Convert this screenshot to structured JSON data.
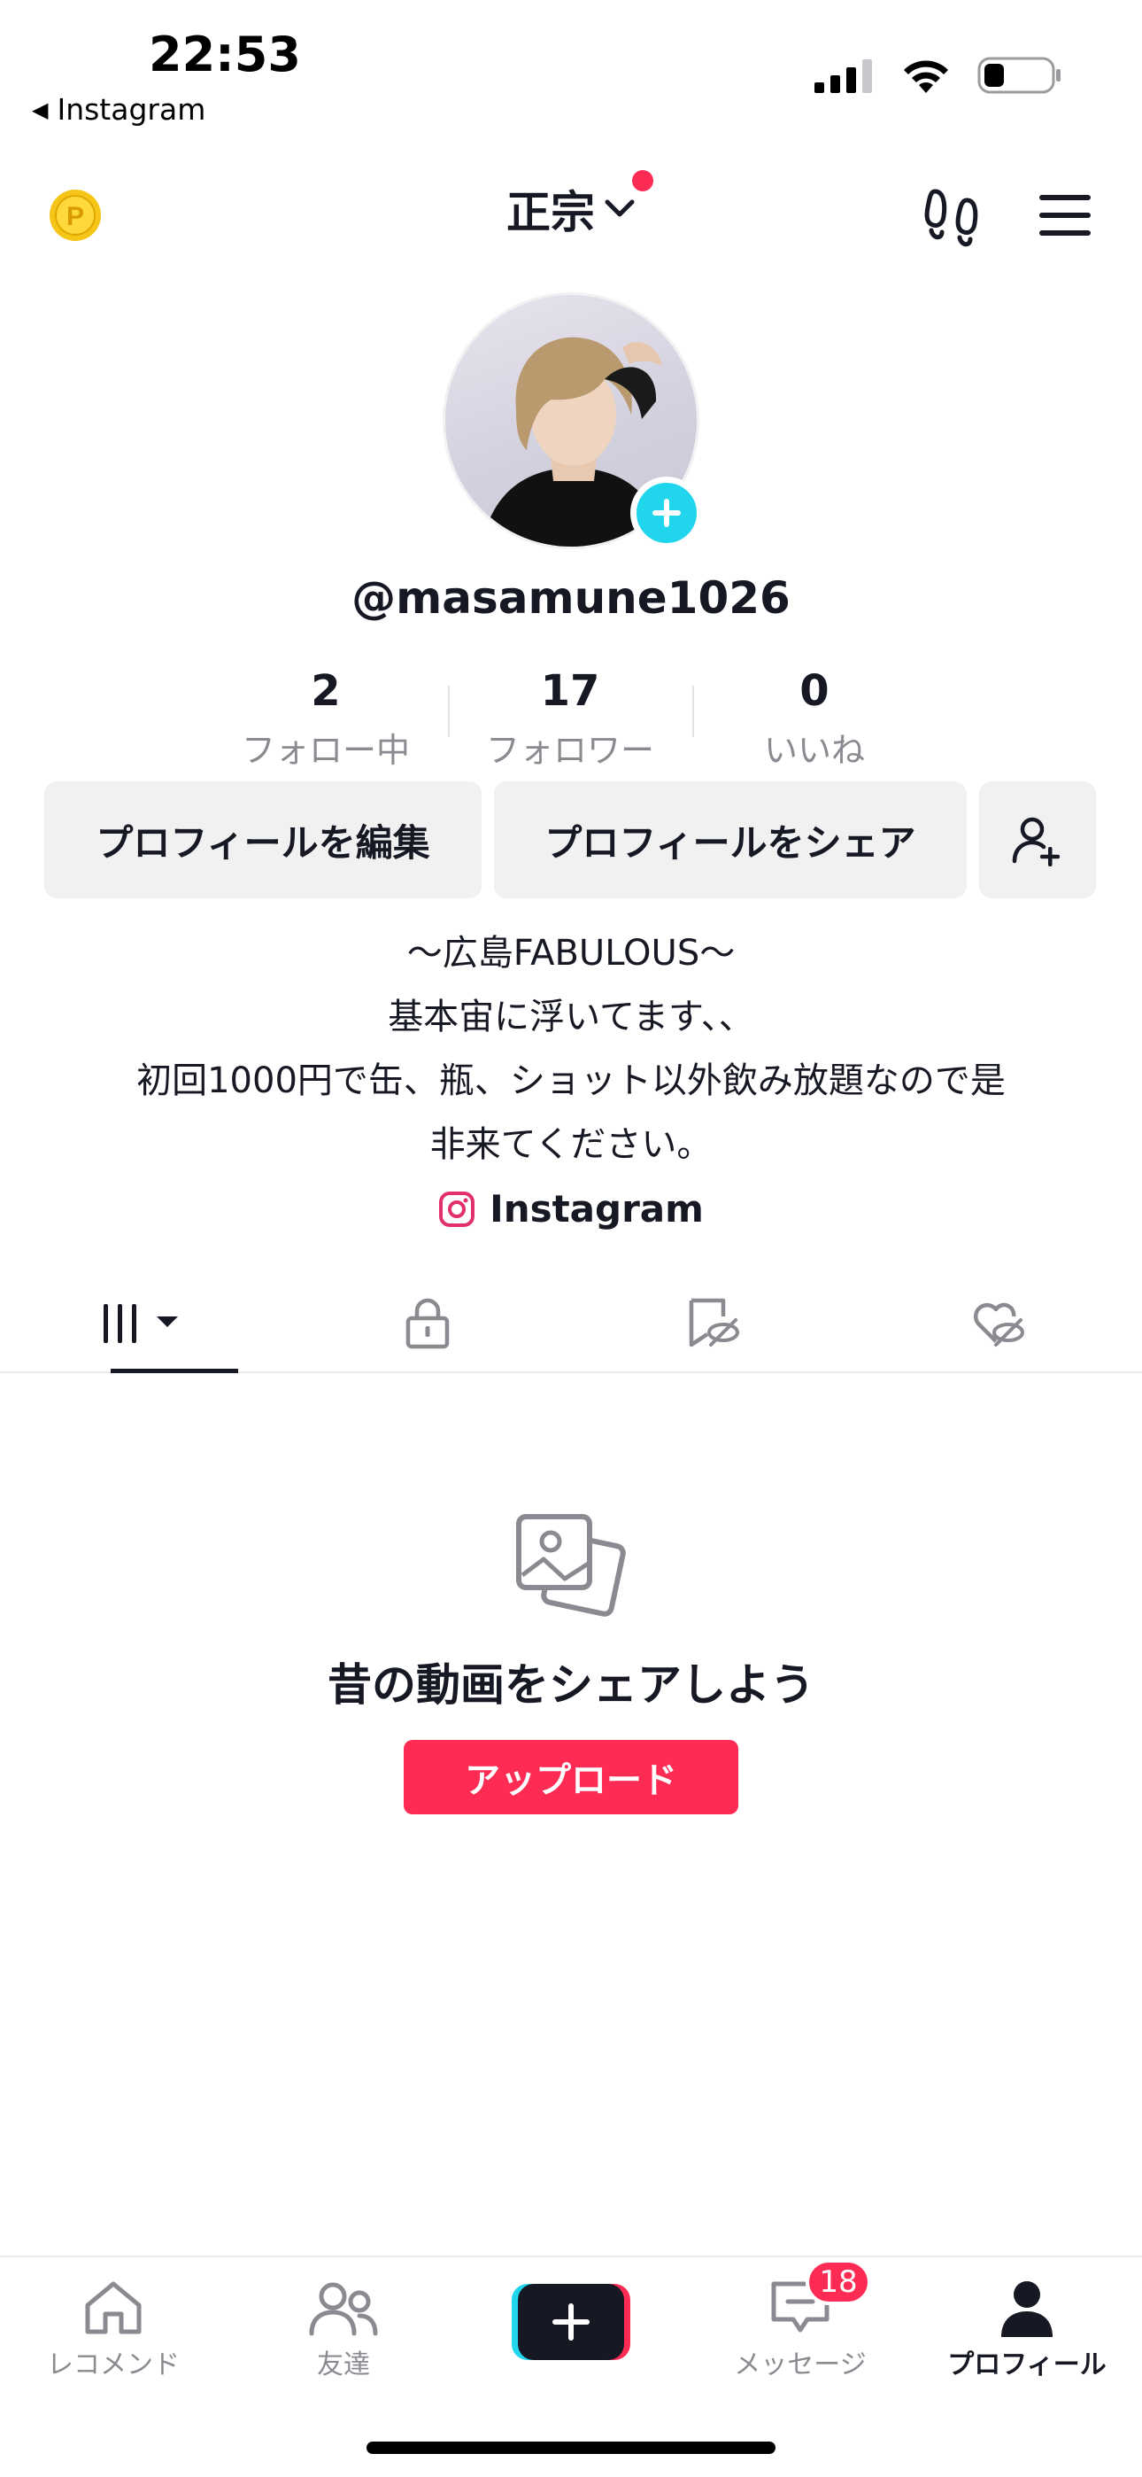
{
  "status_bar": {
    "time": "22:53",
    "back_app": "Instagram"
  },
  "header": {
    "display_name": "正宗",
    "has_notification_dot": true
  },
  "profile": {
    "handle": "@masamune1026",
    "stats": [
      {
        "value": "2",
        "label": "フォロー中"
      },
      {
        "value": "17",
        "label": "フォロワー"
      },
      {
        "value": "0",
        "label": "いいね"
      }
    ],
    "edit_button": "プロフィールを編集",
    "share_button": "プロフィールをシェア",
    "bio_lines": [
      "〜広島FABULOUS〜",
      "基本宙に浮いてます、、",
      "初回1000円で缶、瓶、ショット以外飲み放題なので是",
      "非来てください。"
    ],
    "instagram_label": "Instagram"
  },
  "tabs": [
    {
      "name": "videos",
      "icon": "grid-icon",
      "active": true
    },
    {
      "name": "private",
      "icon": "lock-icon",
      "active": false
    },
    {
      "name": "favorites",
      "icon": "bookmark-hidden-icon",
      "active": false
    },
    {
      "name": "liked",
      "icon": "heart-hidden-icon",
      "active": false
    }
  ],
  "empty_state": {
    "title": "昔の動画をシェアしよう",
    "button": "アップロード"
  },
  "bottom_nav": {
    "items": [
      {
        "label": "レコメンド",
        "icon": "home-icon"
      },
      {
        "label": "友達",
        "icon": "friends-icon"
      },
      {
        "label": "",
        "icon": "create-icon"
      },
      {
        "label": "メッセージ",
        "icon": "inbox-icon",
        "badge": "18"
      },
      {
        "label": "プロフィール",
        "icon": "profile-icon",
        "active": true
      }
    ]
  },
  "colors": {
    "accent": "#fe2c55",
    "teal": "#20d5ec",
    "text": "#161823",
    "muted": "#8a8b91",
    "button_bg": "#f1f1f2"
  }
}
